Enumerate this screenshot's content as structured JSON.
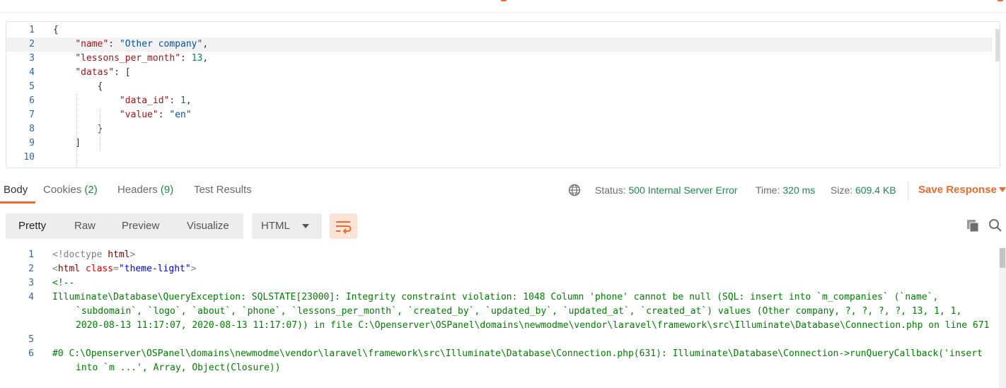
{
  "request_body": {
    "lines": [
      {
        "n": "1",
        "parts": [
          [
            "t-pun",
            "{"
          ]
        ]
      },
      {
        "n": "2",
        "parts": [
          [
            "t-pun",
            "    "
          ],
          [
            "t-key",
            "\"name\""
          ],
          [
            "t-pun",
            ": "
          ],
          [
            "t-str",
            "\"Other company\""
          ],
          [
            "t-pun",
            ","
          ]
        ]
      },
      {
        "n": "3",
        "parts": [
          [
            "t-pun",
            "    "
          ],
          [
            "t-key",
            "\"lessons_per_month\""
          ],
          [
            "t-pun",
            ": "
          ],
          [
            "t-num",
            "13"
          ],
          [
            "t-pun",
            ","
          ]
        ]
      },
      {
        "n": "4",
        "parts": [
          [
            "t-pun",
            "    "
          ],
          [
            "t-key",
            "\"datas\""
          ],
          [
            "t-pun",
            ": ["
          ]
        ]
      },
      {
        "n": "5",
        "parts": [
          [
            "t-pun",
            "        {"
          ]
        ]
      },
      {
        "n": "6",
        "parts": [
          [
            "t-pun",
            "            "
          ],
          [
            "t-key",
            "\"data_id\""
          ],
          [
            "t-pun",
            ": "
          ],
          [
            "t-num",
            "1"
          ],
          [
            "t-pun",
            ","
          ]
        ]
      },
      {
        "n": "7",
        "parts": [
          [
            "t-pun",
            "            "
          ],
          [
            "t-key",
            "\"value\""
          ],
          [
            "t-pun",
            ": "
          ],
          [
            "t-str",
            "\"en\""
          ]
        ]
      },
      {
        "n": "8",
        "parts": [
          [
            "t-pun",
            "        }"
          ]
        ]
      },
      {
        "n": "9",
        "parts": [
          [
            "t-pun",
            "    ]"
          ]
        ]
      },
      {
        "n": "10",
        "parts": [
          [
            "t-pun",
            ""
          ]
        ]
      }
    ]
  },
  "response_tabs": {
    "body": "Body",
    "cookies": "Cookies",
    "cookies_count": "(2)",
    "headers": "Headers",
    "headers_count": "(9)",
    "test_results": "Test Results"
  },
  "status": {
    "status_label": "Status:",
    "status_value": "500 Internal Server Error",
    "time_label": "Time:",
    "time_value": "320 ms",
    "size_label": "Size:",
    "size_value": "609.4 KB",
    "save_response": "Save Response"
  },
  "toolbar": {
    "views": [
      "Pretty",
      "Raw",
      "Preview",
      "Visualize"
    ],
    "selected_view": "Pretty",
    "format": "HTML"
  },
  "response_body": {
    "lines": [
      {
        "n": "1",
        "parts": [
          [
            "c-gray",
            "<!doctype "
          ],
          [
            "c-tag",
            "html"
          ],
          [
            "c-gray",
            ">"
          ]
        ]
      },
      {
        "n": "2",
        "parts": [
          [
            "c-gray",
            "<"
          ],
          [
            "c-tag",
            "html"
          ],
          [
            "c-gray",
            " "
          ],
          [
            "c-attr",
            "class"
          ],
          [
            "c-gray",
            "="
          ],
          [
            "c-val",
            "\"theme-light\""
          ],
          [
            "c-gray",
            ">"
          ]
        ]
      },
      {
        "n": "3",
        "parts": [
          [
            "c-comment",
            "<!--"
          ]
        ]
      },
      {
        "n": "4",
        "wrapped": true,
        "parts": [
          [
            "c-comment",
            "Illuminate\\Database\\QueryException: SQLSTATE[23000]: Integrity constraint violation: 1048 Column 'phone' cannot be null (SQL: insert into `m_companies` (`name`, `subdomain`, `logo`, `about`, `phone`, `lessons_per_month`, `created_by`, `updated_by`, `updated_at`, `created_at`) values (Other company, ?, ?, ?, ?, 13, 1, 1, 2020-08-13 11:17:07, 2020-08-13 11:17:07)) in file C:\\Openserver\\OSPanel\\domains\\newmodme\\vendor\\laravel\\framework\\src\\Illuminate\\Database\\Connection.php on line 671"
          ]
        ]
      },
      {
        "n": "5",
        "parts": [
          [
            "c-comment",
            ""
          ]
        ]
      },
      {
        "n": "6",
        "wrapped": true,
        "parts": [
          [
            "c-comment",
            "#0 C:\\Openserver\\OSPanel\\domains\\newmodme\\vendor\\laravel\\framework\\src\\Illuminate\\Database\\Connection.php(631): Illuminate\\Database\\Connection->runQueryCallback('insert into `m ...', Array, Object(Closure))"
          ]
        ]
      }
    ]
  },
  "colors": {
    "accent": "#ef6a2e",
    "success_text": "#1b8a4b",
    "line_number": "#2b6aa8"
  }
}
